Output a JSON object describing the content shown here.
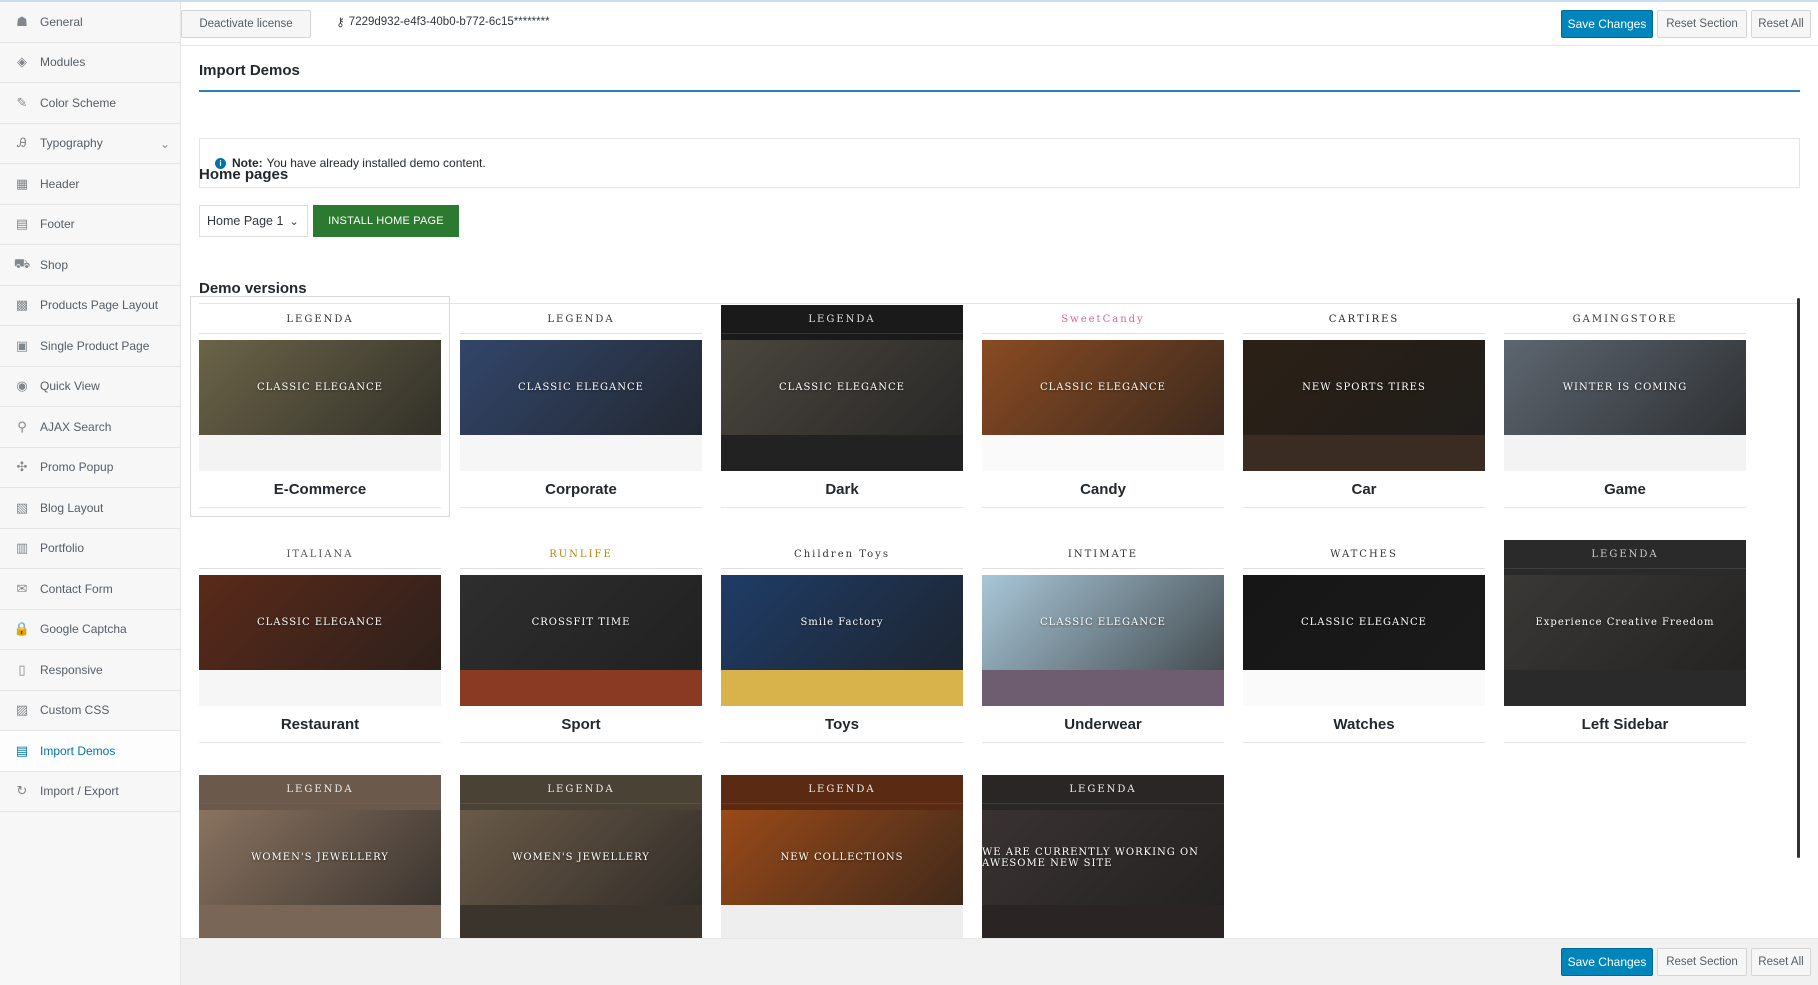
{
  "sidebar": {
    "items": [
      {
        "label": "General",
        "icon": "dashboard-icon",
        "glyph": "☗"
      },
      {
        "label": "Modules",
        "icon": "modules-icon",
        "glyph": "◈"
      },
      {
        "label": "Color Scheme",
        "icon": "brush-icon",
        "glyph": "✎"
      },
      {
        "label": "Typography",
        "icon": "typography-icon",
        "glyph": "Ꭿ"
      },
      {
        "label": "Header",
        "icon": "header-icon",
        "glyph": "▦"
      },
      {
        "label": "Footer",
        "icon": "footer-icon",
        "glyph": "▤"
      },
      {
        "label": "Shop",
        "icon": "cart-icon",
        "glyph": "⛟"
      },
      {
        "label": "Products Page Layout",
        "icon": "grid-icon",
        "glyph": "▩"
      },
      {
        "label": "Single Product Page",
        "icon": "product-icon",
        "glyph": "▣"
      },
      {
        "label": "Quick View",
        "icon": "eye-icon",
        "glyph": "◉"
      },
      {
        "label": "AJAX Search",
        "icon": "search-icon",
        "glyph": "⚲"
      },
      {
        "label": "Promo Popup",
        "icon": "popup-icon",
        "glyph": "✣"
      },
      {
        "label": "Blog Layout",
        "icon": "blog-icon",
        "glyph": "▧"
      },
      {
        "label": "Portfolio",
        "icon": "portfolio-icon",
        "glyph": "▥"
      },
      {
        "label": "Contact Form",
        "icon": "envelope-icon",
        "glyph": "✉"
      },
      {
        "label": "Google Captcha",
        "icon": "lock-icon",
        "glyph": "🔒"
      },
      {
        "label": "Responsive",
        "icon": "mobile-icon",
        "glyph": "▯"
      },
      {
        "label": "Custom CSS",
        "icon": "code-icon",
        "glyph": "▨"
      },
      {
        "label": "Import Demos",
        "icon": "import-icon",
        "glyph": "▤"
      },
      {
        "label": "Import / Export",
        "icon": "refresh-icon",
        "glyph": "↻"
      }
    ],
    "active_label": "Import Demos"
  },
  "topbar": {
    "deactivate_label": "Deactivate license",
    "license_key": "7229d932-e4f3-40b0-b772-6c15********",
    "save_label": "Save Changes",
    "reset_section_label": "Reset Section",
    "reset_all_label": "Reset All"
  },
  "main": {
    "title": "Import Demos",
    "note_label": "Note:",
    "note_text": "You have already installed demo content.",
    "home_pages_title": "Home pages",
    "home_select_value": "Home Page 1",
    "install_label": "INSTALL HOME PAGE",
    "demo_versions_title": "Demo versions"
  },
  "demos": [
    {
      "name": "E-Commerce",
      "brand": "LEGENDA",
      "hero": "CLASSIC ELEGANCE",
      "nav_bg": "#ffffff",
      "nav_fg": "#333333",
      "hero_bg": "#6b6448",
      "foot_bg": "#f3f3f3",
      "selected": true
    },
    {
      "name": "Corporate",
      "brand": "LEGENDA",
      "hero": "CLASSIC ELEGANCE",
      "nav_bg": "#ffffff",
      "nav_fg": "#333333",
      "hero_bg": "#32466a",
      "foot_bg": "#f6f6f6",
      "selected": false
    },
    {
      "name": "Dark",
      "brand": "LEGENDA",
      "hero": "CLASSIC ELEGANCE",
      "nav_bg": "#1a1a1a",
      "nav_fg": "#e0e0e0",
      "hero_bg": "#4a463f",
      "foot_bg": "#222222",
      "selected": false
    },
    {
      "name": "Candy",
      "brand": "SweetCandy",
      "hero": "CLASSIC ELEGANCE",
      "nav_bg": "#ffffff",
      "nav_fg": "#e0609a",
      "hero_bg": "#8a4b22",
      "foot_bg": "#fafafa",
      "selected": false
    },
    {
      "name": "Car",
      "brand": "CARTIRES",
      "hero": "NEW SPORTS TIRES",
      "nav_bg": "#ffffff",
      "nav_fg": "#222222",
      "hero_bg": "#2b2016",
      "foot_bg": "#3a2c22",
      "selected": false
    },
    {
      "name": "Game",
      "brand": "GAMINGSTORE",
      "hero": "WINTER IS COMING",
      "nav_bg": "#ffffff",
      "nav_fg": "#333333",
      "hero_bg": "#5d6670",
      "foot_bg": "#f3f3f3",
      "selected": false
    },
    {
      "name": "Restaurant",
      "brand": "ITALIANA",
      "hero": "CLASSIC ELEGANCE",
      "nav_bg": "#ffffff",
      "nav_fg": "#555555",
      "hero_bg": "#5a2a1a",
      "foot_bg": "#f6f6f6",
      "selected": false
    },
    {
      "name": "Sport",
      "brand": "RUNLIFE",
      "hero": "CROSSFIT TIME",
      "nav_bg": "#ffffff",
      "nav_fg": "#b8860b",
      "hero_bg": "#2e2e2e",
      "foot_bg": "#8a3a22",
      "selected": false
    },
    {
      "name": "Toys",
      "brand": "Children Toys",
      "hero": "Smile Factory",
      "nav_bg": "#ffffff",
      "nav_fg": "#333333",
      "hero_bg": "#1f3c66",
      "foot_bg": "#d8b24a",
      "selected": false
    },
    {
      "name": "Underwear",
      "brand": "INTIMATE",
      "hero": "CLASSIC ELEGANCE",
      "nav_bg": "#ffffff",
      "nav_fg": "#333333",
      "hero_bg": "#a9c7d8",
      "foot_bg": "#6e5d70",
      "selected": false
    },
    {
      "name": "Watches",
      "brand": "WATCHES",
      "hero": "CLASSIC ELEGANCE",
      "nav_bg": "#ffffff",
      "nav_fg": "#333333",
      "hero_bg": "#161616",
      "foot_bg": "#fafafa",
      "selected": false
    },
    {
      "name": "Left Sidebar",
      "brand": "LEGENDA",
      "hero": "Experience Creative Freedom",
      "nav_bg": "#2a2a2a",
      "nav_fg": "#cccccc",
      "hero_bg": "#3a3835",
      "foot_bg": "#2a2a2a",
      "selected": false
    },
    {
      "name": "",
      "brand": "LEGENDA",
      "hero": "WOMEN'S JEWELLERY",
      "nav_bg": "#6b5a4c",
      "nav_fg": "#eeeeee",
      "hero_bg": "#8a7360",
      "foot_bg": "#7a6656",
      "selected": false
    },
    {
      "name": "",
      "brand": "LEGENDA",
      "hero": "WOMEN'S JEWELLERY",
      "nav_bg": "#4b4236",
      "nav_fg": "#eeeeee",
      "hero_bg": "#6a5a48",
      "foot_bg": "#3a342c",
      "selected": false
    },
    {
      "name": "",
      "brand": "LEGENDA",
      "hero": "NEW COLLECTIONS",
      "nav_bg": "#5a2a12",
      "nav_fg": "#eeeeee",
      "hero_bg": "#9a4a18",
      "foot_bg": "#eeeeee",
      "selected": false
    },
    {
      "name": "",
      "brand": "LEGENDA",
      "hero": "WE ARE CURRENTLY WORKING ON AWESOME NEW SITE",
      "nav_bg": "#2a2626",
      "nav_fg": "#eeeeee",
      "hero_bg": "#3a3232",
      "foot_bg": "#2a2424",
      "selected": false
    }
  ]
}
